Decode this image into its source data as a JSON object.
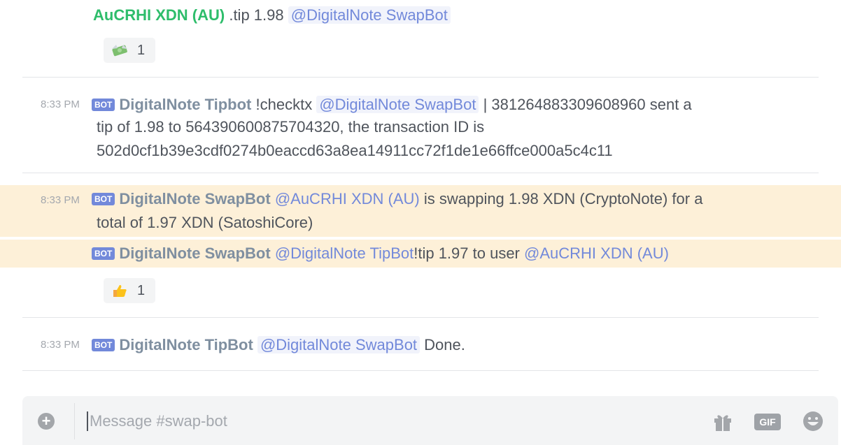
{
  "messages": [
    {
      "author": "AuCRHI XDN (AU)",
      "content": ".tip 1.98",
      "mention": "@DigitalNote SwapBot",
      "reaction": {
        "emoji": "money-with-wings",
        "count": "1"
      }
    },
    {
      "timestamp": "8:33 PM",
      "bot_tag": "BOT",
      "author": "DigitalNote Tipbot",
      "content_pre": "!checktx",
      "mention": "@DigitalNote SwapBot",
      "content_line1": "| 381264883309608960 sent a",
      "content_line2": "tip of 1.98 to 564390600875704320, the transaction ID is",
      "content_line3": "502d0cf1b39e3cdf0274b0eaccd63a8ea14911cc72f1de1e66ffce000a5c4c11"
    },
    {
      "timestamp": "8:33 PM",
      "bot_tag": "BOT",
      "author": "DigitalNote SwapBot",
      "mention": "@AuCRHI XDN (AU)",
      "content_line1": "is swapping 1.98 XDN (CryptoNote) for a",
      "content_line2": "total of 1.97 XDN (SatoshiCore)",
      "followup": {
        "bot_tag": "BOT",
        "author": "DigitalNote SwapBot",
        "mention1": "@DigitalNote TipBot",
        "content": "!tip 1.97 to user",
        "mention2": "@AuCRHI XDN (AU)"
      },
      "reaction": {
        "emoji": "thumbs-up",
        "count": "1"
      }
    },
    {
      "timestamp": "8:33 PM",
      "bot_tag": "BOT",
      "author": "DigitalNote TipBot",
      "mention": "@DigitalNote SwapBot",
      "content": "Done."
    }
  ],
  "composer": {
    "placeholder": "Message #swap-bot",
    "value": "",
    "gif_label": "GIF",
    "icons": [
      "plus-icon",
      "gift-icon",
      "gif-icon",
      "smile-icon"
    ]
  },
  "colors": {
    "highlight": "#fdf0d8",
    "mention": "#7289da",
    "bot_badge": "#7289da",
    "author_user": "#2ebd6b",
    "author_bot": "#7f8fa0"
  }
}
